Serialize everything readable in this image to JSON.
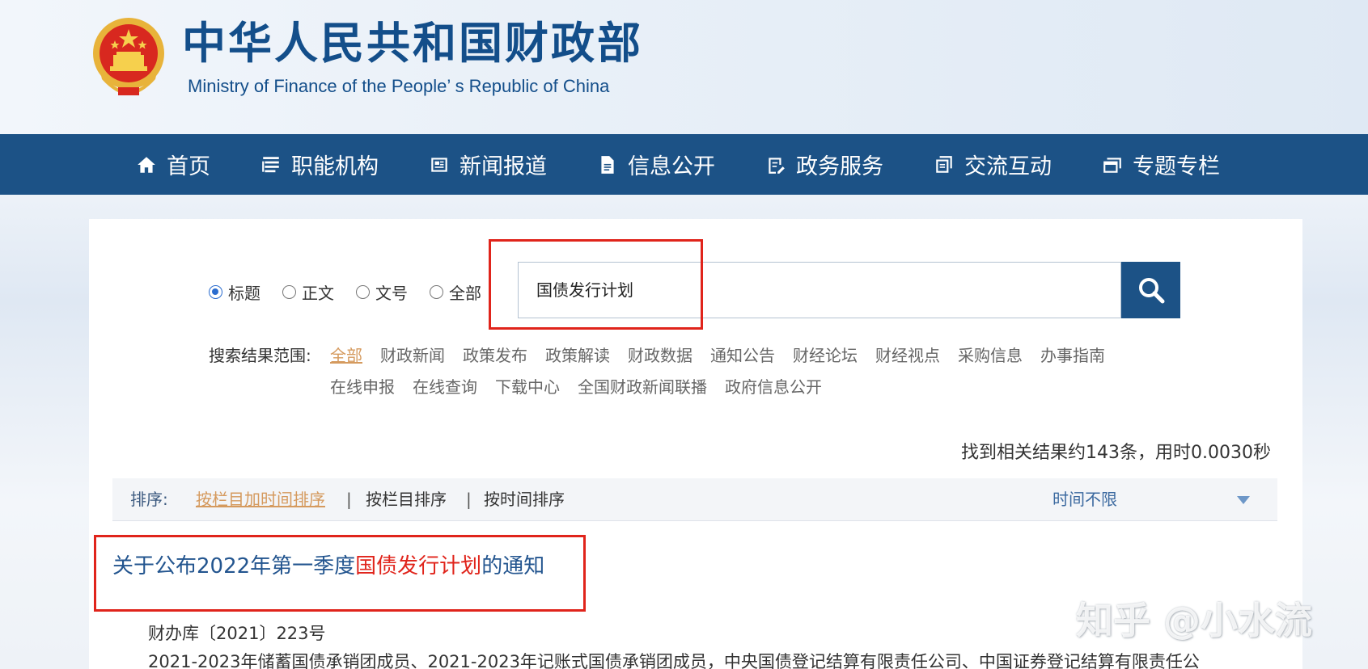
{
  "header": {
    "title": "中华人民共和国财政部",
    "subtitle": "Ministry of Finance of the People’ s Republic of China"
  },
  "nav": [
    {
      "label": "首页",
      "icon": "home-icon"
    },
    {
      "label": "职能机构",
      "icon": "list-icon"
    },
    {
      "label": "新闻报道",
      "icon": "newspaper-icon"
    },
    {
      "label": "信息公开",
      "icon": "document-icon"
    },
    {
      "label": "政务服务",
      "icon": "clipboard-icon"
    },
    {
      "label": "交流互动",
      "icon": "chat-icon"
    },
    {
      "label": "专题专栏",
      "icon": "window-icon"
    }
  ],
  "search": {
    "fields": [
      {
        "label": "标题",
        "checked": true
      },
      {
        "label": "正文",
        "checked": false
      },
      {
        "label": "文号",
        "checked": false
      },
      {
        "label": "全部",
        "checked": false
      }
    ],
    "query": "国债发行计划"
  },
  "scope": {
    "label": "搜索结果范围:",
    "row1": [
      "全部",
      "财政新闻",
      "政策发布",
      "政策解读",
      "财政数据",
      "通知公告",
      "财经论坛",
      "财经视点",
      "采购信息",
      "办事指南"
    ],
    "row2": [
      "在线申报",
      "在线查询",
      "下载中心",
      "全国财政新闻联播",
      "政府信息公开"
    ],
    "active": "全部"
  },
  "results": {
    "count_text": "找到相关结果约143条，用时0.0030秒"
  },
  "sort": {
    "label": "排序:",
    "options": [
      "按栏目加时间排序",
      "按栏目排序",
      "按时间排序"
    ],
    "separator": "|",
    "time_filter": "时间不限"
  },
  "result_item": {
    "title_prefix": "关于公布2022年第一季度",
    "title_highlight": "国债发行计划",
    "title_suffix": "的通知",
    "doc_no": "财办库〔2021〕223号",
    "snippet": "2021-2023年储蓄国债承销团成员、2021-2023年记账式国债承销团成员，中央国债登记结算有限责任公司、中国证券登记结算有限责任公"
  },
  "watermark": "知乎 @小水流",
  "colors": {
    "nav_bg": "#1c5286",
    "highlight": "#e0241b",
    "active_link": "#d59a5e",
    "title_link": "#23558f"
  }
}
